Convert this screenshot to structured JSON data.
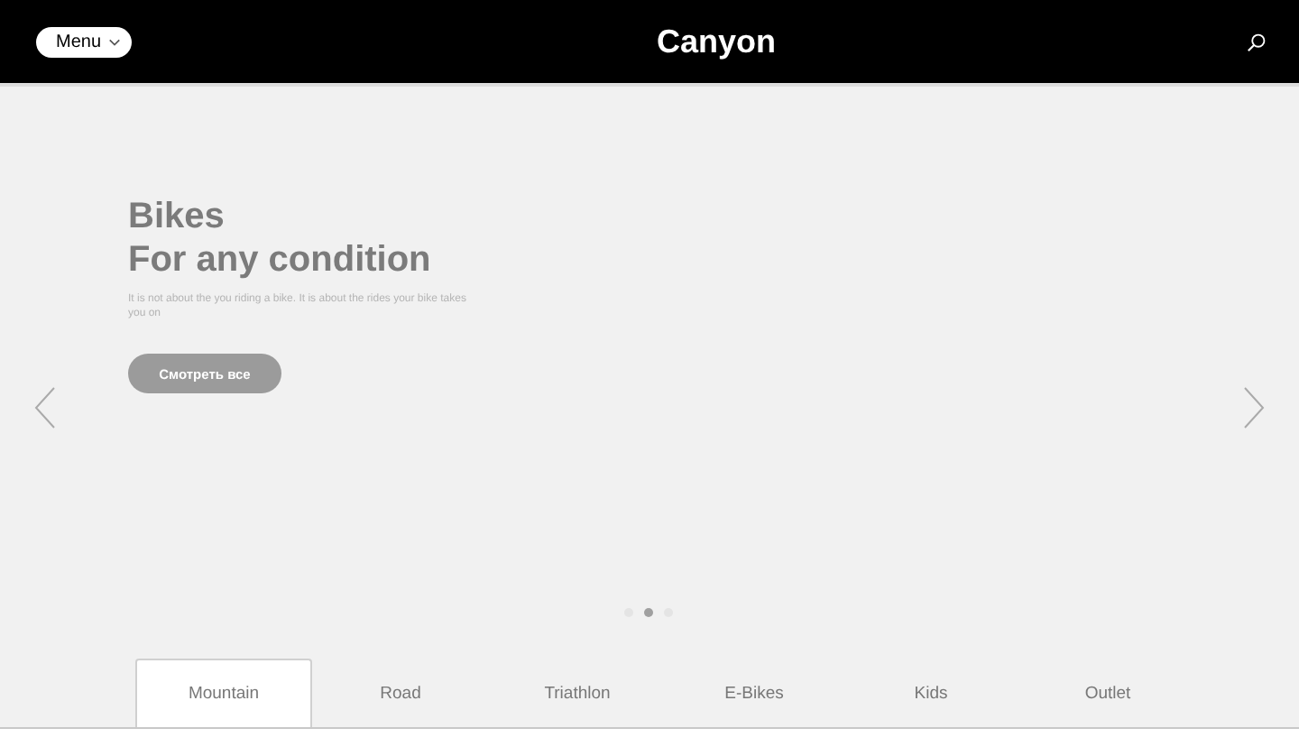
{
  "header": {
    "menu_button": "Menu",
    "logo": "Canyon"
  },
  "hero": {
    "title": "Bikes",
    "subtitle": "For any condition",
    "description": "It is not about the you riding a bike. It is about the rides your bike takes you on",
    "button": "Смотреть все",
    "dots": [
      {
        "selected": false
      },
      {
        "selected": true
      },
      {
        "selected": false
      }
    ]
  },
  "tabs": [
    {
      "label": "Mountain",
      "selected": true
    },
    {
      "label": "Road",
      "selected": false
    },
    {
      "label": "Triathlon",
      "selected": false
    },
    {
      "label": "E-Bikes",
      "selected": false
    },
    {
      "label": "Kids",
      "selected": false
    },
    {
      "label": "Outlet",
      "selected": false
    }
  ]
}
